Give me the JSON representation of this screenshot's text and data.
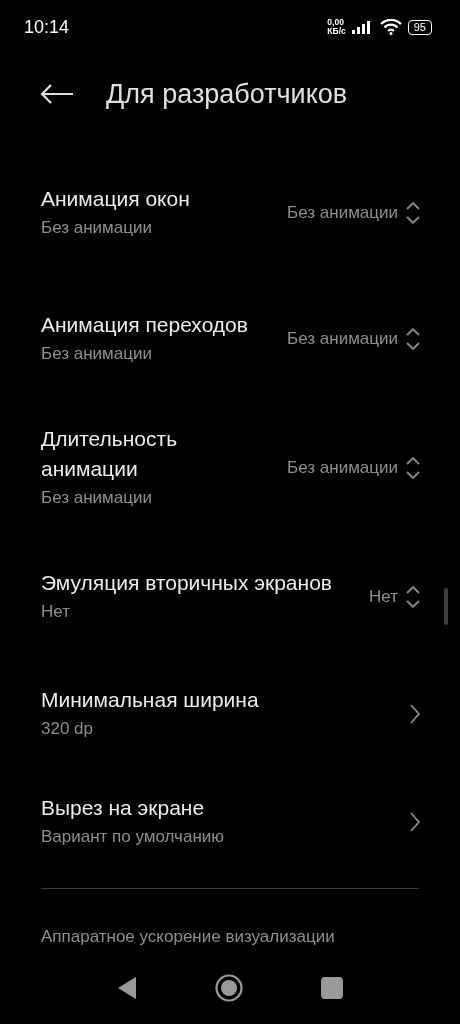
{
  "status_bar": {
    "time": "10:14",
    "speed_value": "0,00",
    "speed_unit": "КБ/с",
    "battery": "95"
  },
  "header": {
    "title": "Для разработчиков"
  },
  "settings": [
    {
      "kind": "dropdown",
      "title": "Анимация окон",
      "summary": "Без анимации",
      "value": "Без анимации"
    },
    {
      "kind": "dropdown",
      "title": "Анимация переходов",
      "summary": "Без анимации",
      "value": "Без анимации"
    },
    {
      "kind": "dropdown",
      "title": "Длительность анимации",
      "summary": "Без анимации",
      "value": "Без анимации"
    },
    {
      "kind": "dropdown",
      "title": "Эмуляция вторичных экранов",
      "summary": "Нет",
      "value": "Нет"
    },
    {
      "kind": "link",
      "title": "Минимальная ширина",
      "summary": "320 dp"
    },
    {
      "kind": "link",
      "title": "Вырез на экране",
      "summary": "Вариант по умолчанию"
    }
  ],
  "section_header": "Аппаратное ускорение визуализации"
}
